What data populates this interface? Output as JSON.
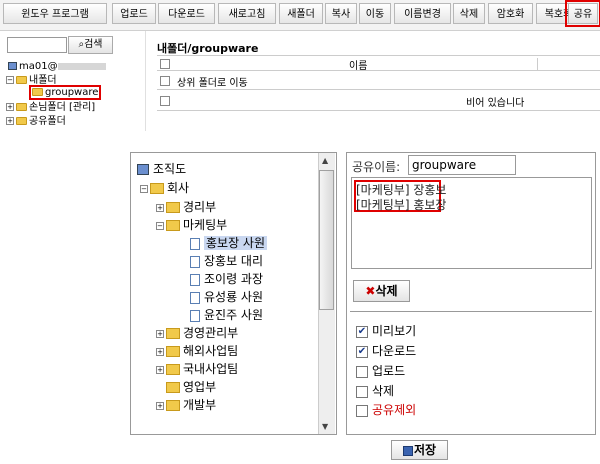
{
  "toolbar": {
    "buttons": [
      "윈도우 프로그램",
      "업로드",
      "다운로드",
      "새로고침",
      "새폴더",
      "복사",
      "이동",
      "이름변경",
      "삭제",
      "암호화",
      "복호화",
      "공유"
    ]
  },
  "left_tree": {
    "search_placeholder": "",
    "search_label": "검색",
    "user": "ma01@",
    "my_folder": "내폴더",
    "groupware": "groupware",
    "guest_folder": "손님폴더 [관리]",
    "shared_folder": "공유폴더"
  },
  "file_panel": {
    "path": "내폴더/groupware",
    "column_name": "이름",
    "parent_row": "상위 폴더로 이동",
    "empty": "비어 있습니다"
  },
  "org_tree": {
    "root": "조직도",
    "company": "회사",
    "nodes": [
      "경리부",
      "마케팅부",
      "홍보장 사원",
      "장홍보 대리",
      "조이령 과장",
      "유성룡 사원",
      "윤진주 사원",
      "경영관리부",
      "해외사업팀",
      "국내사업팀",
      "영업부",
      "개발부"
    ]
  },
  "share": {
    "name_label": "공유이름:",
    "name_value": "groupware",
    "members": [
      "[마케팅부] 장홍보",
      "[마케팅부] 홍보장"
    ],
    "delete_label": "삭제",
    "permissions": [
      {
        "label": "미리보기",
        "checked": true
      },
      {
        "label": "다운로드",
        "checked": true
      },
      {
        "label": "업로드",
        "checked": false
      },
      {
        "label": "삭제",
        "checked": false
      },
      {
        "label": "공유제외",
        "checked": false
      }
    ],
    "save_label": "저장"
  },
  "colors": {
    "highlight": "#e00000",
    "folder": "#f1c94a",
    "selected": "#c9d7f0",
    "remove_share": "#cc0000"
  }
}
